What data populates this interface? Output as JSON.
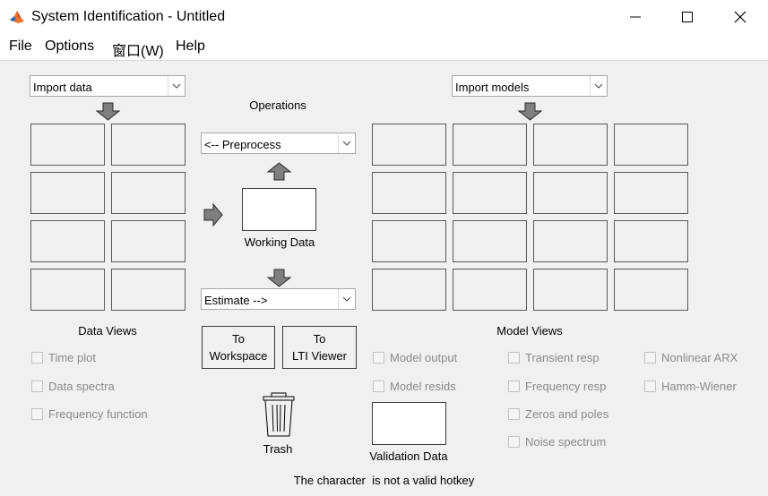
{
  "window": {
    "title": "System Identification - Untitled",
    "minimize_icon": "minimize-icon",
    "maximize_icon": "maximize-icon",
    "close_icon": "close-icon"
  },
  "menu": {
    "file": "File",
    "options": "Options",
    "window": "窗口(W)",
    "help": "Help"
  },
  "data_panel": {
    "import_select": "Import data",
    "views_title": "Data Views",
    "views": [
      {
        "label": "Time plot"
      },
      {
        "label": "Data spectra"
      },
      {
        "label": "Frequency function"
      }
    ]
  },
  "operations": {
    "title": "Operations",
    "preprocess_select": "<-- Preprocess",
    "working_data_label": "Working Data",
    "estimate_select": "Estimate -->",
    "to_workspace": [
      "To",
      "Workspace"
    ],
    "to_lti_viewer": [
      "To",
      "LTI Viewer"
    ],
    "trash_label": "Trash",
    "validation_label": "Validation Data"
  },
  "model_panel": {
    "import_select": "Import models",
    "views_title": "Model Views",
    "views_col1": [
      {
        "label": "Model output"
      },
      {
        "label": "Model resids"
      }
    ],
    "views_col2": [
      {
        "label": "Transient resp"
      },
      {
        "label": "Frequency resp"
      },
      {
        "label": "Zeros and poles"
      },
      {
        "label": "Noise spectrum"
      }
    ],
    "views_col3": [
      {
        "label": "Nonlinear ARX"
      },
      {
        "label": "Hamm-Wiener"
      }
    ]
  },
  "status": {
    "message": "The character  is not a valid hotkey"
  },
  "colors": {
    "background": "#f0f0f0",
    "disabled_text": "#8a8a8a",
    "arrow_fill": "#7f7f7f"
  }
}
